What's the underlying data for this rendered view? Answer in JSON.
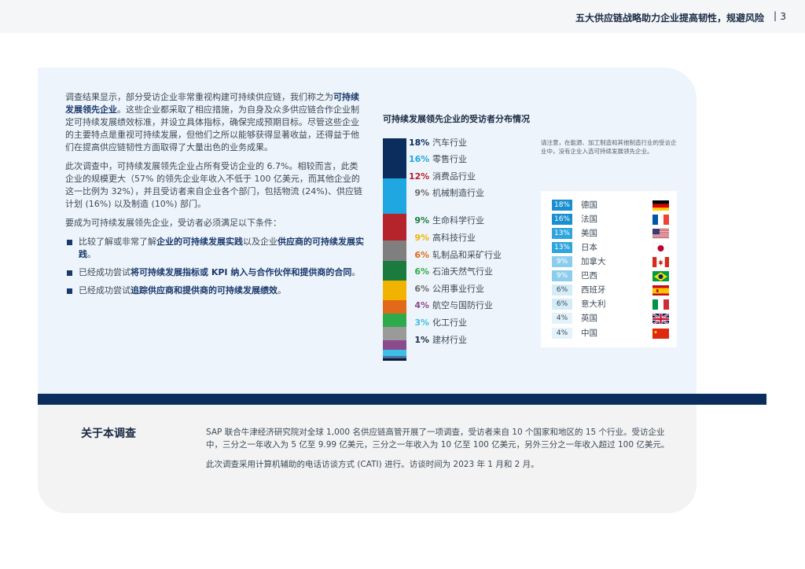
{
  "header": {
    "title": "五大供应链战略助力企业提高韧性，规避风险",
    "separator": "|",
    "page": "3"
  },
  "intro": {
    "p1_pre": "调查结果显示，部分受访企业非常重视构建可持续供应链，我们称之为",
    "p1_bold": "可持续发展领先企业",
    "p1_post": "。这些企业都采取了相应措施，为自身及众多供应链合作企业制定可持续发展绩效标准，并设立具体指标，确保完成预期目标。尽管这些企业的主要特点是重视可持续发展，但他们之所以能够获得显著收益，还得益于他们在提高供应链韧性方面取得了大量出色的业务成果。",
    "p2": "此次调查中，可持续发展领先企业占所有受访企业的 6.7%。相较而言，此类企业的规模更大（57% 的领先企业年收入不低于 100 亿美元，而其他企业的这一比例为 32%），并且受访者来自企业各个部门，包括物流 (24%)、供应链计划 (16%) 以及制造 (10%) 部门。",
    "p3": "要成为可持续发展领先企业，受访者必须满足以下条件：",
    "b1_pre": "比较了解或非常了解",
    "b1_bold1": "企业的可持续发展实践",
    "b1_mid": "以及企业",
    "b1_bold2": "供应商的可持续发展实践",
    "b1_post": "。",
    "b2_pre": "已经成功尝试",
    "b2_bold": "将可持续发展指标或 KPI 纳入与合作伙伴和提供商的合同",
    "b2_post": "。",
    "b3_pre": "已经成功尝试",
    "b3_bold": "追踪供应商和提供商的可持续发展绩效",
    "b3_post": "。"
  },
  "chart_data": {
    "type": "bar",
    "title": "可持续发展领先企业的受访者分布情况",
    "categories": [
      "汽车行业",
      "零售行业",
      "消费品行业",
      "机械制造行业",
      "生命科学行业",
      "高科技行业",
      "轧制品和采矿行业",
      "石油天然气行业",
      "公用事业行业",
      "航空与国防行业",
      "化工行业",
      "建材行业"
    ],
    "labels": [
      "18%",
      "16%",
      "12%",
      "9%",
      "9%",
      "9%",
      "6%",
      "6%",
      "6%",
      "4%",
      "3%",
      "1%"
    ],
    "values": [
      18,
      16,
      12,
      9,
      9,
      9,
      6,
      6,
      6,
      4,
      3,
      1
    ],
    "colors": [
      "#0b2d5e",
      "#1ea7e1",
      "#b5232b",
      "#7f7f7f",
      "#1b7a3e",
      "#f2b300",
      "#e06a1a",
      "#2dab4a",
      "#9a9a9a",
      "#8a4a8c",
      "#3dbfe6",
      "#4a6fa5"
    ]
  },
  "note": "请注意，在能源、加工制造和其他制造行业的受访企业中，没有企业入选可持续发展领先企业。",
  "countries": [
    {
      "pct": "18%",
      "name": "德国",
      "bg": "#1a8fd0",
      "fg": "#ffffff",
      "flag": "de"
    },
    {
      "pct": "16%",
      "name": "法国",
      "bg": "#1a8fd0",
      "fg": "#ffffff",
      "flag": "fr"
    },
    {
      "pct": "13%",
      "name": "美国",
      "bg": "#2fa5dd",
      "fg": "#ffffff",
      "flag": "us"
    },
    {
      "pct": "13%",
      "name": "日本",
      "bg": "#2fa5dd",
      "fg": "#ffffff",
      "flag": "jp"
    },
    {
      "pct": "9%",
      "name": "加拿大",
      "bg": "#8ccdee",
      "fg": "#ffffff",
      "flag": "ca"
    },
    {
      "pct": "9%",
      "name": "巴西",
      "bg": "#8ccdee",
      "fg": "#ffffff",
      "flag": "br"
    },
    {
      "pct": "6%",
      "name": "西班牙",
      "bg": "#d3ecf8",
      "fg": "#3c4a58",
      "flag": "es"
    },
    {
      "pct": "6%",
      "name": "意大利",
      "bg": "#d3ecf8",
      "fg": "#3c4a58",
      "flag": "it"
    },
    {
      "pct": "4%",
      "name": "英国",
      "bg": "#e4f2fa",
      "fg": "#3c4a58",
      "flag": "gb"
    },
    {
      "pct": "4%",
      "name": "中国",
      "bg": "#e4f2fa",
      "fg": "#3c4a58",
      "flag": "cn"
    }
  ],
  "about": {
    "heading": "关于本调查",
    "p1": "SAP 联合牛津经济研究院对全球 1,000 名供应链高管开展了一项调查，受访者来自 10 个国家和地区的 15 个行业。受访企业中，三分之一年收入为 5 亿至 9.99 亿美元，三分之一年收入为 10 亿至 100 亿美元，另外三分之一年收入超过 100 亿美元。",
    "p2": "此次调查采用计算机辅助的电话访谈方式 (CATI) 进行。访谈时间为 2023 年 1 月和 2 月。"
  }
}
